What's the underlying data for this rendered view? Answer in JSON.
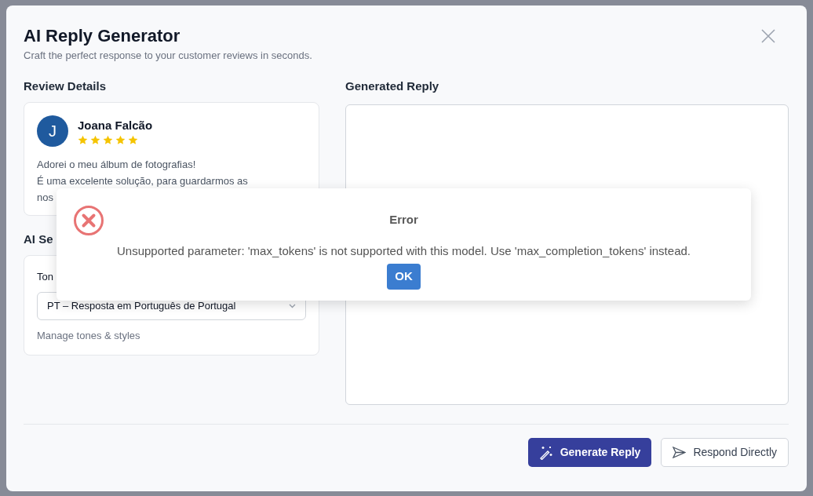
{
  "dialog": {
    "title": "AI Reply Generator",
    "subtitle": "Craft the perfect response to your customer reviews in seconds."
  },
  "review_details": {
    "heading": "Review Details",
    "reviewer": {
      "initial": "J",
      "name": "Joana Falcão",
      "stars": 5
    },
    "text_lines": [
      "Adorei o meu álbum de fotografias!",
      "É uma excelente solução, para guardarmos as",
      "nos"
    ]
  },
  "ai_settings": {
    "heading": "AI Se",
    "tone_label": "Ton",
    "tone_value": "PT – Resposta em Português de Portugal",
    "manage_link": "Manage tones & styles"
  },
  "generated_reply": {
    "heading": "Generated Reply"
  },
  "buttons": [
    {
      "kind": "primary",
      "label": "Generate Reply"
    },
    {
      "kind": "secondary",
      "label": "Respond Directly"
    }
  ],
  "error_alert": {
    "title": "Error",
    "message": "Unsupported parameter: 'max_tokens' is not supported with this model. Use 'max_completion_tokens' instead.",
    "button": "OK"
  }
}
